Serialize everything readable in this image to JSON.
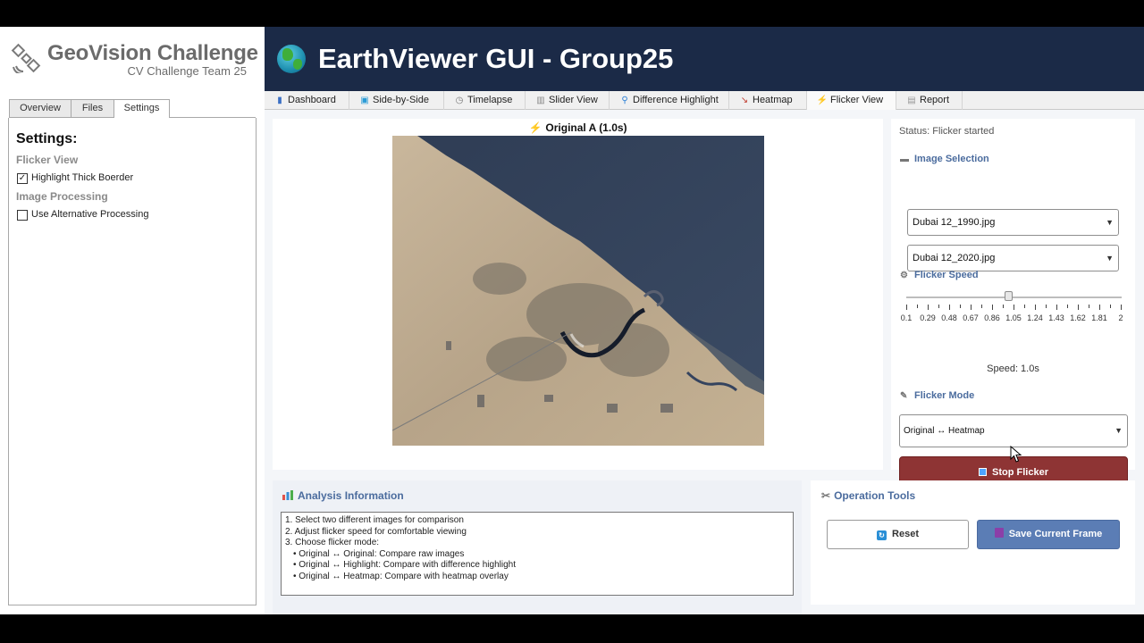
{
  "sidebar": {
    "logo_title": "GeoVision Challenge",
    "logo_subtitle": "CV Challenge Team 25",
    "tabs": [
      {
        "label": "Overview"
      },
      {
        "label": "Files"
      },
      {
        "label": "Settings"
      }
    ],
    "active_tab": "Settings",
    "settings": {
      "title": "Settings:",
      "flicker_section": "Flicker View",
      "highlight_label": "Highlight Thick Boerder",
      "highlight_checked": true,
      "processing_section": "Image Processing",
      "alt_processing_label": "Use Alternative Processing",
      "alt_processing_checked": false
    }
  },
  "header": {
    "title": "EarthViewer GUI - Group25",
    "icon": "globe-icon"
  },
  "main_tabs": [
    {
      "label": "Dashboard",
      "icon": "bar-chart-icon"
    },
    {
      "label": "Side-by-Side",
      "icon": "split-view-icon"
    },
    {
      "label": "Timelapse",
      "icon": "stopwatch-icon"
    },
    {
      "label": "Slider View",
      "icon": "slider-icon"
    },
    {
      "label": "Difference Highlight",
      "icon": "magnifier-icon"
    },
    {
      "label": "Heatmap",
      "icon": "trend-icon"
    },
    {
      "label": "Flicker View",
      "icon": "lightning-icon"
    },
    {
      "label": "Report",
      "icon": "document-icon"
    }
  ],
  "active_main_tab": "Flicker View",
  "viewer": {
    "caption": "Original A (1.0s)"
  },
  "controls": {
    "status": "Status: Flicker started",
    "image_selection_label": "Image Selection",
    "image_a": "Dubai 12_1990.jpg",
    "image_b": "Dubai 12_2020.jpg",
    "flicker_speed_label": "Flicker Speed",
    "speed_min": 0.1,
    "speed_max": 2,
    "speed_value": 1.0,
    "speed_ticks": [
      "0.1",
      "0.29",
      "0.48",
      "0.67",
      "0.86",
      "1.05",
      "1.24",
      "1.43",
      "1.62",
      "1.81",
      "2"
    ],
    "speed_text": "Speed: 1.0s",
    "flicker_mode_label": "Flicker Mode",
    "flicker_mode_value": "Original ↔ Heatmap",
    "stop_button": "Stop Flicker"
  },
  "analysis": {
    "title": "Analysis Information",
    "lines": [
      "1. Select two different images for comparison",
      "2. Adjust flicker speed for comfortable viewing",
      "3. Choose flicker mode:",
      "• Original ↔ Original: Compare raw images",
      "• Original ↔ Highlight: Compare with difference highlight",
      "• Original ↔ Heatmap: Compare with heatmap overlay"
    ]
  },
  "operation_tools": {
    "title": "Operation Tools",
    "reset_button": "Reset",
    "save_button": "Save Current Frame"
  },
  "colors": {
    "header_bg": "#1b2a47",
    "accent_blue": "#4b6c9e",
    "stop_button": "#8e3434",
    "save_button": "#5b7db5"
  }
}
